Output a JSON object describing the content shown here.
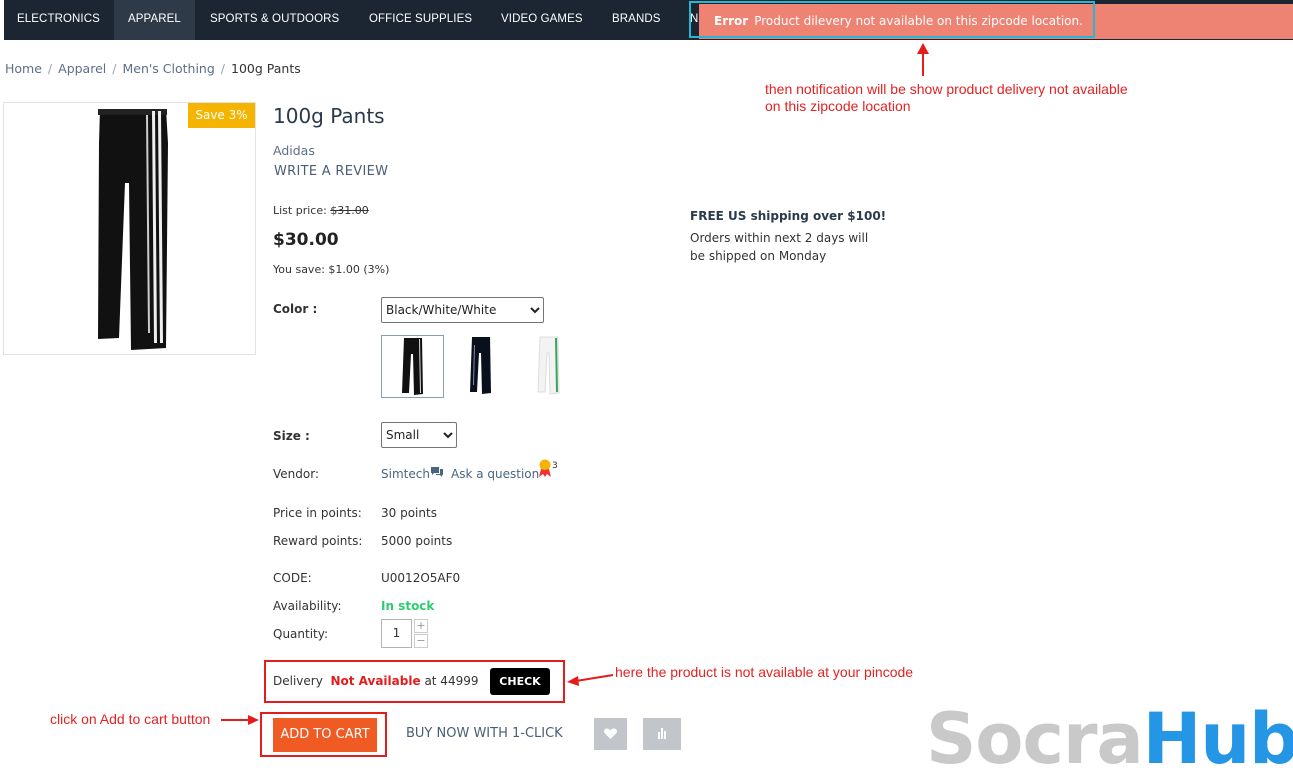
{
  "nav": {
    "items": [
      "ELECTRONICS",
      "APPAREL",
      "SPORTS & OUTDOORS",
      "OFFICE SUPPLIES",
      "VIDEO GAMES",
      "BRANDS",
      "N"
    ],
    "active": "APPAREL"
  },
  "error": {
    "title": "Error",
    "message": "Product dilevery not available on this zipcode location."
  },
  "annotations": {
    "error_note_line1": "then notification will be show product delivery not available",
    "error_note_line2": "on this zipcode location",
    "delivery_note": "here the product is not available at your pincode",
    "cart_note": "click on Add to cart button"
  },
  "breadcrumb": {
    "items": [
      "Home",
      "Apparel",
      "Men's Clothing"
    ],
    "current": "100g Pants",
    "separator": "/"
  },
  "product": {
    "save_badge": "Save 3%",
    "title": "100g Pants",
    "brand": "Adidas",
    "review_link": "WRITE A REVIEW",
    "list_price_label": "List price:",
    "list_price": "$31.00",
    "price": "$30.00",
    "you_save": "You save: $1.00 (3%)",
    "color_label": "Color :",
    "color_value": "Black/White/White",
    "size_label": "Size :",
    "size_value": "Small",
    "vendor_label": "Vendor:",
    "vendor": "Simtech",
    "ask_question": "Ask a question",
    "badge_count": "3",
    "points_label": "Price in points:",
    "points": "30 points",
    "reward_label": "Reward points:",
    "reward": "5000 points",
    "code_label": "CODE:",
    "code": "U0012O5AF0",
    "availability_label": "Availability:",
    "availability": "In stock",
    "quantity_label": "Quantity:",
    "quantity": "1",
    "qty_plus": "+",
    "qty_minus": "−"
  },
  "shipping": {
    "title": "FREE US shipping over $100!",
    "line1": "Orders within next 2 days will",
    "line2": "be shipped on Monday"
  },
  "delivery": {
    "label": "Delivery",
    "status": "Not Available",
    "at": "at 44999",
    "check": "CHECK"
  },
  "actions": {
    "add_to_cart": "ADD TO CART",
    "buy_now": "BUY NOW WITH 1-CLICK"
  },
  "watermark": {
    "part1": "Socra",
    "part2": "Hub"
  },
  "colors": {
    "nav_bg": "#1c2633",
    "error_bg": "#ef8373",
    "cart_btn": "#f05a23",
    "in_stock": "#2ecc71",
    "not_available": "#e31c1c",
    "watermark_gray": "#c9c9c9",
    "watermark_blue": "#2596e6"
  },
  "icons": [
    "chat-icon",
    "award-badge-icon",
    "heart-icon",
    "bar-chart-icon",
    "arrow-up-icon",
    "arrow-left-icon",
    "arrow-right-icon"
  ]
}
